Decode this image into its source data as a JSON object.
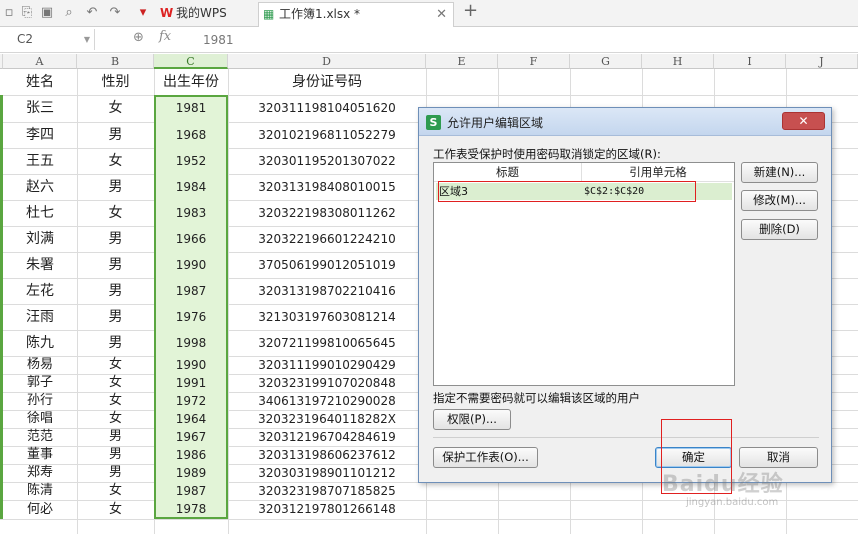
{
  "tabs": [
    {
      "label": "我的WPS",
      "icon": "wps-logo-icon"
    },
    {
      "label": "工作簿1.xlsx *",
      "icon": "spreadsheet-file-icon"
    }
  ],
  "formula_bar": {
    "cell_ref": "C2",
    "fx_label": "fx",
    "value": "1981"
  },
  "columns": [
    "A",
    "B",
    "C",
    "D",
    "E",
    "F",
    "G",
    "H",
    "I",
    "J"
  ],
  "headers": {
    "name": "姓名",
    "gender": "性别",
    "birth_year": "出生年份",
    "id": "身份证号码"
  },
  "rows": [
    {
      "name": "张三",
      "gender": "女",
      "year": "1981",
      "id": "320311198104051620"
    },
    {
      "name": "李四",
      "gender": "男",
      "year": "1968",
      "id": "320102196811052279"
    },
    {
      "name": "王五",
      "gender": "女",
      "year": "1952",
      "id": "320301195201307022"
    },
    {
      "name": "赵六",
      "gender": "男",
      "year": "1984",
      "id": "320313198408010015"
    },
    {
      "name": "杜七",
      "gender": "女",
      "year": "1983",
      "id": "320322198308011262"
    },
    {
      "name": "刘满",
      "gender": "男",
      "year": "1966",
      "id": "320322196601224210"
    },
    {
      "name": "朱署",
      "gender": "男",
      "year": "1990",
      "id": "370506199012051019"
    },
    {
      "name": "左花",
      "gender": "男",
      "year": "1987",
      "id": "320313198702210416"
    },
    {
      "name": "汪雨",
      "gender": "男",
      "year": "1976",
      "id": "321303197603081214"
    },
    {
      "name": "陈九",
      "gender": "男",
      "year": "1998",
      "id": "320721199810065645"
    },
    {
      "name": "杨易",
      "gender": "女",
      "year": "1990",
      "id": "320311199010290429"
    },
    {
      "name": "郭子",
      "gender": "女",
      "year": "1991",
      "id": "320323199107020848"
    },
    {
      "name": "孙行",
      "gender": "女",
      "year": "1972",
      "id": "340613197210290028"
    },
    {
      "name": "徐唱",
      "gender": "女",
      "year": "1964",
      "id": "32032319640118282X"
    },
    {
      "name": "范范",
      "gender": "男",
      "year": "1967",
      "id": "320312196704284619"
    },
    {
      "name": "董事",
      "gender": "男",
      "year": "1986",
      "id": "320313198606237612"
    },
    {
      "name": "郑寿",
      "gender": "男",
      "year": "1989",
      "id": "320303198901101212"
    },
    {
      "name": "陈清",
      "gender": "女",
      "year": "1987",
      "id": "320323198707185825"
    },
    {
      "name": "何必",
      "gender": "女",
      "year": "1978",
      "id": "320312197801266148"
    }
  ],
  "dialog": {
    "title": "允许用户编辑区域",
    "close_label": "✕",
    "description": "工作表受保护时使用密码取消锁定的区域(R):",
    "col_title": "标题",
    "col_ref": "引用单元格",
    "range_name": "区域3",
    "range_ref": "$C$2:$C$20",
    "btn_new": "新建(N)...",
    "btn_modify": "修改(M)...",
    "btn_delete": "删除(D)",
    "note": "指定不需要密码就可以编辑该区域的用户",
    "btn_permissions": "权限(P)...",
    "btn_protect": "保护工作表(O)...",
    "btn_ok": "确定",
    "btn_cancel": "取消"
  },
  "watermark": {
    "text": "Baidu经验",
    "sub": "jingyan.baidu.com"
  }
}
